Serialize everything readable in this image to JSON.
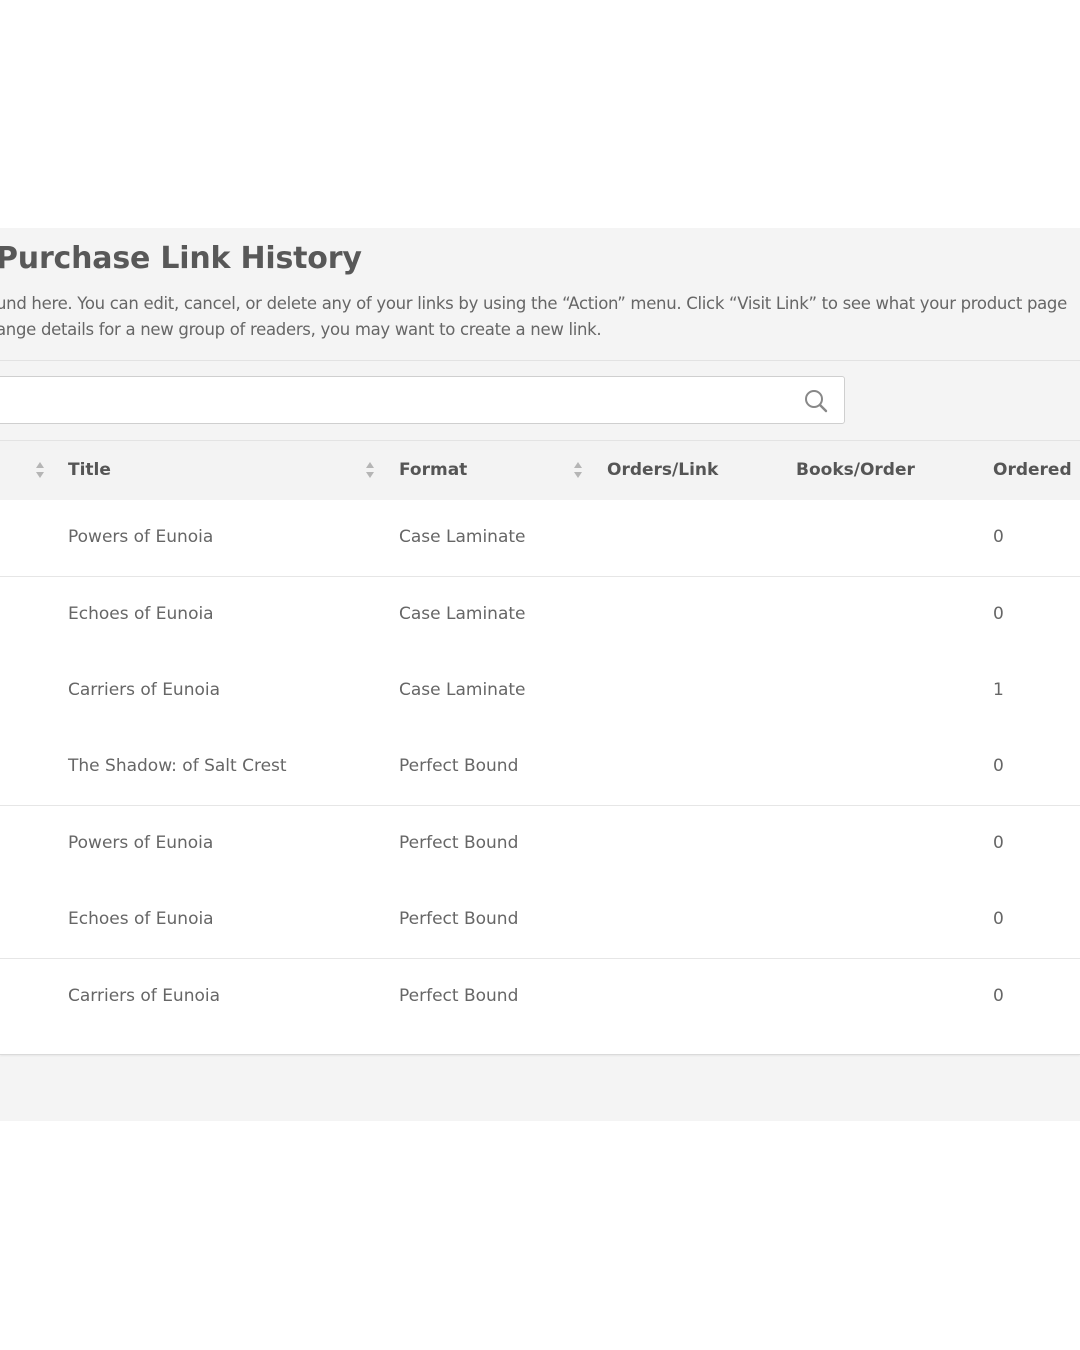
{
  "header": {
    "title": "Purchase Link History",
    "description_line1": "und here. You can edit, cancel, or delete any of your links by using the “Action” menu. Click “Visit Link” to see what your product page",
    "description_line2": "ange details for a new group of readers, you may want to create a new link."
  },
  "search": {
    "placeholder": "",
    "value": "",
    "icon": "search-icon"
  },
  "table": {
    "columns": [
      "Title",
      "Format",
      "Orders/Link",
      "Books/Order",
      "Ordered"
    ],
    "rows": [
      {
        "title": "Powers of Eunoia",
        "format": "Case Laminate",
        "orders_link": "",
        "books_order": "",
        "ordered": "0"
      },
      {
        "title": "Echoes of Eunoia",
        "format": "Case Laminate",
        "orders_link": "",
        "books_order": "",
        "ordered": "0"
      },
      {
        "title": "Carriers of Eunoia",
        "format": "Case Laminate",
        "orders_link": "",
        "books_order": "",
        "ordered": "1"
      },
      {
        "title": "The Shadow: of Salt Crest",
        "format": "Perfect Bound",
        "orders_link": "",
        "books_order": "",
        "ordered": "0"
      },
      {
        "title": "Powers of Eunoia",
        "format": "Perfect Bound",
        "orders_link": "",
        "books_order": "",
        "ordered": "0"
      },
      {
        "title": "Echoes of Eunoia",
        "format": "Perfect Bound",
        "orders_link": "",
        "books_order": "",
        "ordered": "0"
      },
      {
        "title": "Carriers of Eunoia",
        "format": "Perfect Bound",
        "orders_link": "",
        "books_order": "",
        "ordered": "0"
      }
    ]
  },
  "colors": {
    "panel_bg": "#f4f4f4",
    "header_bg": "#f3f3f3",
    "text": "#555555"
  }
}
